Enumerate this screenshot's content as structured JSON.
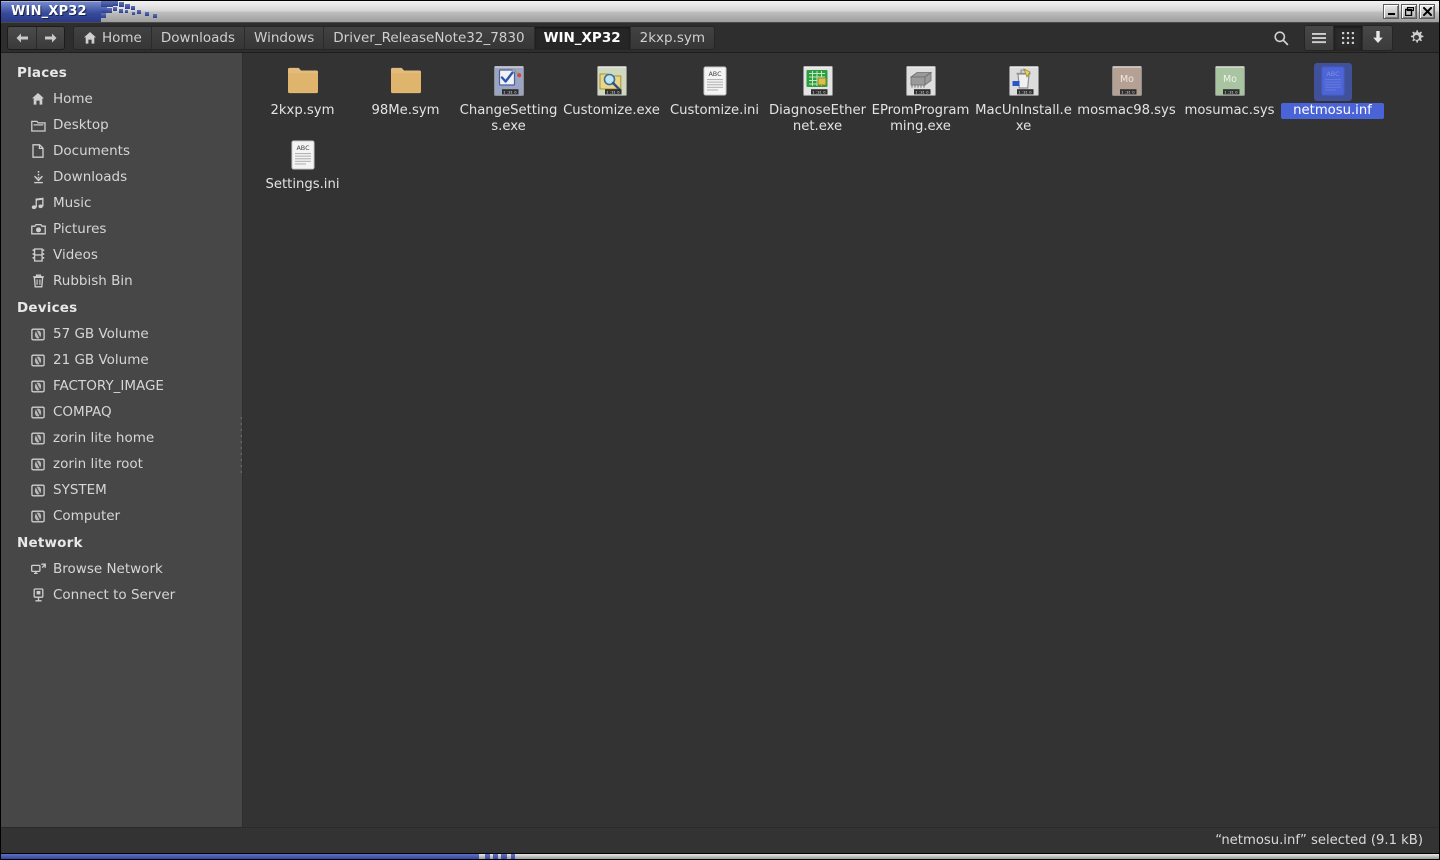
{
  "window": {
    "title": "WIN_XP32",
    "controls": [
      {
        "name": "minimize",
        "glyph": "minimize-icon"
      },
      {
        "name": "maximize",
        "glyph": "maximize-icon"
      },
      {
        "name": "close",
        "glyph": "close-icon"
      }
    ]
  },
  "toolbar": {
    "back_label": "Back",
    "forward_label": "Forward",
    "breadcrumbs": [
      {
        "label": "Home",
        "icon": "home-icon",
        "active": false
      },
      {
        "label": "Downloads",
        "icon": "",
        "active": false
      },
      {
        "label": "Windows",
        "icon": "",
        "active": false
      },
      {
        "label": "Driver_ReleaseNote32_7830",
        "icon": "",
        "active": false
      },
      {
        "label": "WIN_XP32",
        "icon": "",
        "active": true
      },
      {
        "label": "2kxp.sym",
        "icon": "",
        "active": false
      }
    ],
    "actions": [
      {
        "name": "search-icon",
        "label": "Search",
        "active": false
      },
      {
        "name": "list-view-icon",
        "label": "List view",
        "active": false
      },
      {
        "name": "grid-view-icon",
        "label": "Icon view",
        "active": true
      },
      {
        "name": "download-icon",
        "label": "Downloads",
        "active": false
      },
      {
        "name": "gear-icon",
        "label": "Settings",
        "active": false
      }
    ]
  },
  "sidebar": {
    "sections": [
      {
        "title": "Places",
        "items": [
          {
            "label": "Home",
            "icon": "home-icon"
          },
          {
            "label": "Desktop",
            "icon": "folder-icon"
          },
          {
            "label": "Documents",
            "icon": "document-icon"
          },
          {
            "label": "Downloads",
            "icon": "download-icon"
          },
          {
            "label": "Music",
            "icon": "music-icon"
          },
          {
            "label": "Pictures",
            "icon": "camera-icon"
          },
          {
            "label": "Videos",
            "icon": "film-icon"
          },
          {
            "label": "Rubbish Bin",
            "icon": "trash-icon"
          }
        ]
      },
      {
        "title": "Devices",
        "items": [
          {
            "label": "57 GB Volume",
            "icon": "drive-icon"
          },
          {
            "label": "21 GB Volume",
            "icon": "drive-icon"
          },
          {
            "label": "FACTORY_IMAGE",
            "icon": "drive-icon"
          },
          {
            "label": "COMPAQ",
            "icon": "drive-icon"
          },
          {
            "label": "zorin lite home",
            "icon": "drive-icon"
          },
          {
            "label": "zorin lite root",
            "icon": "drive-icon"
          },
          {
            "label": "SYSTEM",
            "icon": "drive-icon"
          },
          {
            "label": "Computer",
            "icon": "drive-icon"
          }
        ]
      },
      {
        "title": "Network",
        "items": [
          {
            "label": "Browse Network",
            "icon": "network-icon"
          },
          {
            "label": "Connect to Server",
            "icon": "server-icon"
          }
        ]
      }
    ]
  },
  "files": [
    {
      "name": "2kxp.sym",
      "icon": "folder-icon",
      "selected": false
    },
    {
      "name": "98Me.sym",
      "icon": "folder-icon",
      "selected": false
    },
    {
      "name": "ChangeSettings.exe",
      "icon": "exe-checkbox-icon",
      "selected": false
    },
    {
      "name": "Customize.exe",
      "icon": "exe-folder-search-icon",
      "selected": false
    },
    {
      "name": "Customize.ini",
      "icon": "text-document-icon",
      "selected": false
    },
    {
      "name": "DiagnoseEthernet.exe",
      "icon": "exe-circuit-icon",
      "selected": false
    },
    {
      "name": "EPromProgramming.exe",
      "icon": "exe-chip-icon",
      "selected": false
    },
    {
      "name": "MacUnInstall.exe",
      "icon": "exe-uninstall-icon",
      "selected": false
    },
    {
      "name": "mosmac98.sys",
      "icon": "sys-tan-icon",
      "selected": false
    },
    {
      "name": "mosumac.sys",
      "icon": "sys-green-icon",
      "selected": false
    },
    {
      "name": "netmosu.inf",
      "icon": "inf-document-icon",
      "selected": true
    },
    {
      "name": "Settings.ini",
      "icon": "text-document-icon",
      "selected": false
    }
  ],
  "statusbar": {
    "text": "“netmosu.inf” selected (9.1 kB)"
  },
  "colors": {
    "title_accent": "#3a4da0",
    "selection": "#4a64d8",
    "sidebar_bg": "#474747",
    "pane_bg": "#333333",
    "folder": "#e0b877"
  }
}
